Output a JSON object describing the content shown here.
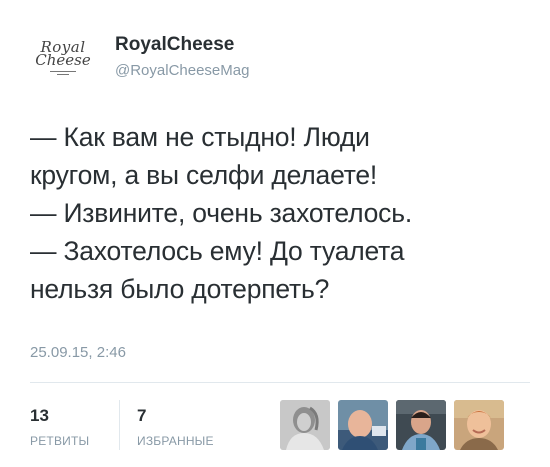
{
  "account": {
    "logo_line1": "Royal",
    "logo_line2": "Cheese",
    "name": "RoyalCheese",
    "handle": "@RoyalCheeseMag"
  },
  "tweet": {
    "lines": [
      "— Как вам не стыдно! Люди",
      "кругом, а вы селфи делаете!",
      "— Извините, очень захотелось.",
      "— Захотелось ему! До туалета",
      "нельзя было дотерпеть?"
    ],
    "timestamp": "25.09.15, 2:46"
  },
  "stats": {
    "retweets_count": "13",
    "retweets_label": "РЕТВИТЫ",
    "favorites_count": "7",
    "favorites_label": "ИЗБРАННЫЕ"
  },
  "avatars": [
    {
      "icon": "user-avatar-1"
    },
    {
      "icon": "user-avatar-2"
    },
    {
      "icon": "user-avatar-3"
    },
    {
      "icon": "user-avatar-4"
    }
  ]
}
